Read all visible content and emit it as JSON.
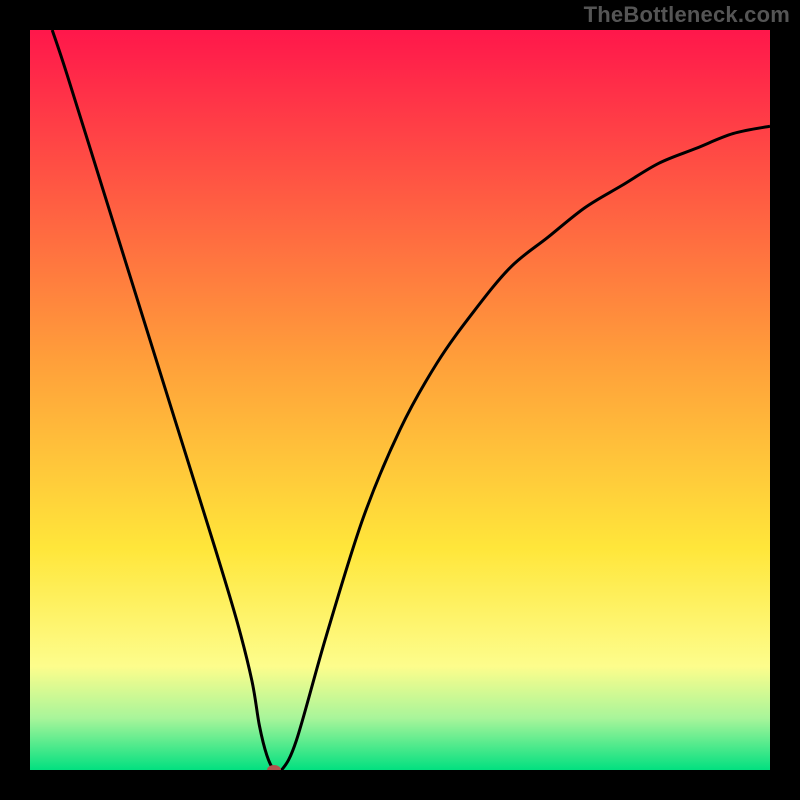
{
  "watermark": "TheBottleneck.com",
  "colors": {
    "black": "#000000",
    "red_top": "#ff174b",
    "orange": "#ffa03a",
    "yellow": "#ffe63a",
    "yellow_light": "#fdfd8c",
    "green_light": "#a8f59a",
    "green_bottom": "#02e080",
    "curve": "#000000",
    "marker": "#b1534e"
  },
  "chart_data": {
    "type": "line",
    "title": "",
    "xlabel": "",
    "ylabel": "",
    "xlim": [
      0,
      100
    ],
    "ylim": [
      0,
      100
    ],
    "series": [
      {
        "name": "bottleneck-curve",
        "x": [
          3,
          5,
          10,
          15,
          20,
          25,
          28,
          30,
          31,
          32,
          33,
          34,
          36,
          40,
          45,
          50,
          55,
          60,
          65,
          70,
          75,
          80,
          85,
          90,
          95,
          100
        ],
        "y": [
          100,
          94,
          78,
          62,
          46,
          30,
          20,
          12,
          6,
          2,
          0,
          0,
          4,
          18,
          34,
          46,
          55,
          62,
          68,
          72,
          76,
          79,
          82,
          84,
          86,
          87
        ]
      }
    ],
    "marker": {
      "x": 33,
      "y": 0
    },
    "background_gradient_stops": [
      {
        "pos": 0,
        "color": "#ff174b"
      },
      {
        "pos": 45,
        "color": "#ffa03a"
      },
      {
        "pos": 70,
        "color": "#ffe63a"
      },
      {
        "pos": 86,
        "color": "#fdfd8c"
      },
      {
        "pos": 93,
        "color": "#a8f59a"
      },
      {
        "pos": 100,
        "color": "#02e080"
      }
    ]
  }
}
